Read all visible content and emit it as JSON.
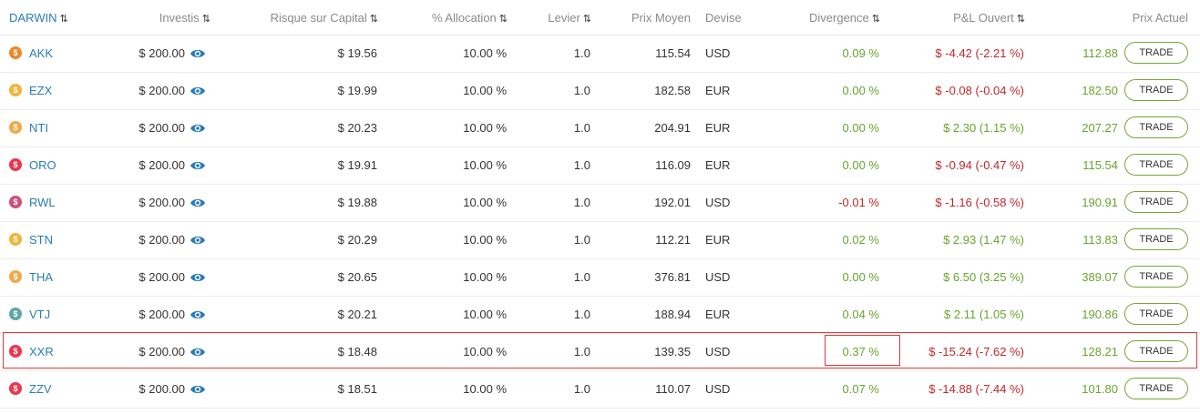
{
  "columns": {
    "darwin": "DARWIN",
    "investis": "Investis",
    "risque": "Risque sur Capital",
    "allocation": "% Allocation",
    "levier": "Levier",
    "prix_moyen": "Prix Moyen",
    "devise": "Devise",
    "divergence": "Divergence",
    "pl_ouvert": "P&L Ouvert",
    "prix_actuel": "Prix Actuel"
  },
  "sort_icon": "⇅",
  "trade_label": "TRADE",
  "coin_symbol": "$",
  "rows": [
    {
      "darwin": "AKK",
      "coin_color": "#e8892b",
      "investis": "$ 200.00",
      "risque": "$ 19.56",
      "allocation": "10.00 %",
      "levier": "1.0",
      "prix_moyen": "115.54",
      "devise": "USD",
      "divergence": "0.09 %",
      "div_sign": "pos",
      "pl_amount": "$ -4.42",
      "pl_pct": "(-2.21 %)",
      "pl_sign": "neg",
      "prix_actuel": "112.88"
    },
    {
      "darwin": "EZX",
      "coin_color": "#f0b63a",
      "investis": "$ 200.00",
      "risque": "$ 19.99",
      "allocation": "10.00 %",
      "levier": "1.0",
      "prix_moyen": "182.58",
      "devise": "EUR",
      "divergence": "0.00 %",
      "div_sign": "pos",
      "pl_amount": "$ -0.08",
      "pl_pct": "(-0.04 %)",
      "pl_sign": "neg",
      "prix_actuel": "182.50"
    },
    {
      "darwin": "NTI",
      "coin_color": "#f0a848",
      "investis": "$ 200.00",
      "risque": "$ 20.23",
      "allocation": "10.00 %",
      "levier": "1.0",
      "prix_moyen": "204.91",
      "devise": "EUR",
      "divergence": "0.00 %",
      "div_sign": "pos",
      "pl_amount": "$ 2.30",
      "pl_pct": "(1.15 %)",
      "pl_sign": "pos",
      "prix_actuel": "207.27"
    },
    {
      "darwin": "ORO",
      "coin_color": "#e8384f",
      "investis": "$ 200.00",
      "risque": "$ 19.91",
      "allocation": "10.00 %",
      "levier": "1.0",
      "prix_moyen": "116.09",
      "devise": "EUR",
      "divergence": "0.00 %",
      "div_sign": "pos",
      "pl_amount": "$ -0.94",
      "pl_pct": "(-0.47 %)",
      "pl_sign": "neg",
      "prix_actuel": "115.54"
    },
    {
      "darwin": "RWL",
      "coin_color": "#cc4f7c",
      "investis": "$ 200.00",
      "risque": "$ 19.88",
      "allocation": "10.00 %",
      "levier": "1.0",
      "prix_moyen": "192.01",
      "devise": "USD",
      "divergence": "-0.01 %",
      "div_sign": "neg",
      "pl_amount": "$ -1.16",
      "pl_pct": "(-0.58 %)",
      "pl_sign": "neg",
      "prix_actuel": "190.91"
    },
    {
      "darwin": "STN",
      "coin_color": "#f0b63a",
      "investis": "$ 200.00",
      "risque": "$ 20.29",
      "allocation": "10.00 %",
      "levier": "1.0",
      "prix_moyen": "112.21",
      "devise": "EUR",
      "divergence": "0.02 %",
      "div_sign": "pos",
      "pl_amount": "$ 2.93",
      "pl_pct": "(1.47 %)",
      "pl_sign": "pos",
      "prix_actuel": "113.83"
    },
    {
      "darwin": "THA",
      "coin_color": "#f0a848",
      "investis": "$ 200.00",
      "risque": "$ 20.65",
      "allocation": "10.00 %",
      "levier": "1.0",
      "prix_moyen": "376.81",
      "devise": "USD",
      "divergence": "0.00 %",
      "div_sign": "pos",
      "pl_amount": "$ 6.50",
      "pl_pct": "(3.25 %)",
      "pl_sign": "pos",
      "prix_actuel": "389.07"
    },
    {
      "darwin": "VTJ",
      "coin_color": "#5fa6a6",
      "investis": "$ 200.00",
      "risque": "$ 20.21",
      "allocation": "10.00 %",
      "levier": "1.0",
      "prix_moyen": "188.94",
      "devise": "EUR",
      "divergence": "0.04 %",
      "div_sign": "pos",
      "pl_amount": "$ 2.11",
      "pl_pct": "(1.05 %)",
      "pl_sign": "pos",
      "prix_actuel": "190.86"
    },
    {
      "darwin": "XXR",
      "coin_color": "#e8384f",
      "investis": "$ 200.00",
      "risque": "$ 18.48",
      "allocation": "10.00 %",
      "levier": "1.0",
      "prix_moyen": "139.35",
      "devise": "USD",
      "divergence": "0.37 %",
      "div_sign": "pos",
      "pl_amount": "$ -15.24",
      "pl_pct": "(-7.62 %)",
      "pl_sign": "neg",
      "prix_actuel": "128.21"
    },
    {
      "darwin": "ZZV",
      "coin_color": "#e8384f",
      "investis": "$ 200.00",
      "risque": "$ 18.51",
      "allocation": "10.00 %",
      "levier": "1.0",
      "prix_moyen": "110.07",
      "devise": "USD",
      "divergence": "0.07 %",
      "div_sign": "pos",
      "pl_amount": "$ -14.88",
      "pl_pct": "(-7.44 %)",
      "pl_sign": "neg",
      "prix_actuel": "101.80"
    }
  ],
  "colors": {
    "positive": "#6aa22f",
    "negative": "#c0272d",
    "link": "#2a7bb5",
    "eye_icon": "#2a7bb5",
    "trade_border": "#7aa53a",
    "highlight": "#e03a3a"
  }
}
